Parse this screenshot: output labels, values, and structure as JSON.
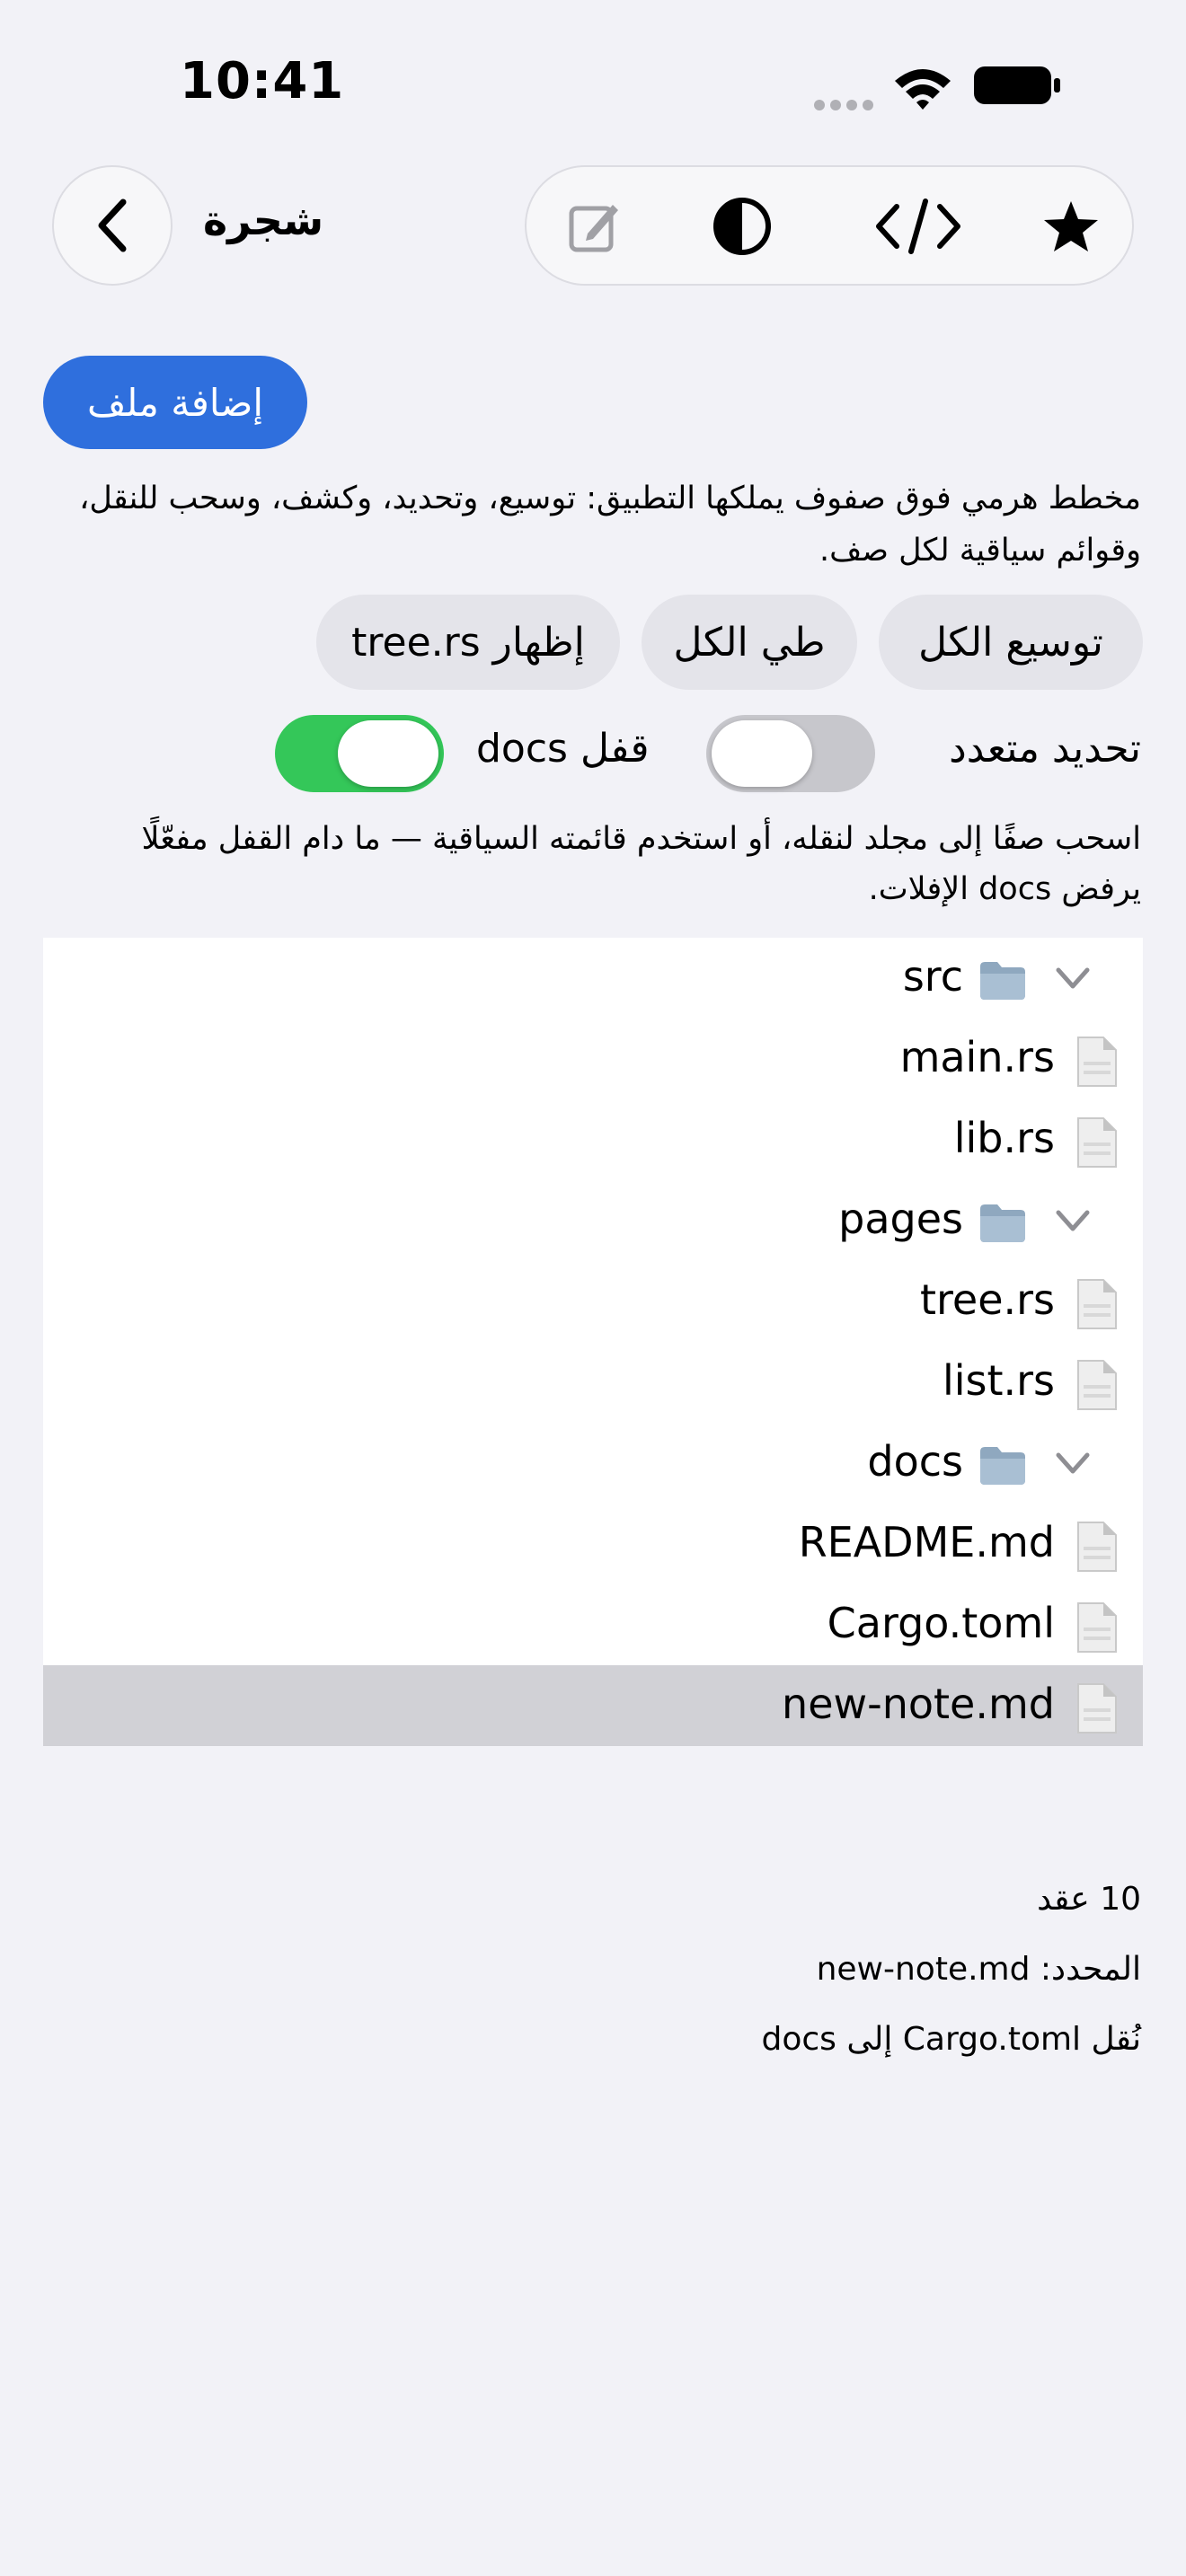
{
  "status_bar": {
    "time": "10:41"
  },
  "nav": {
    "title": "شجرة"
  },
  "actions": {
    "add_file": "إضافة ملف",
    "expand_all": "توسيع الكل",
    "collapse_all": "طي الكل",
    "show_tree": "إظهار tree.rs"
  },
  "description": "مخطط هرمي فوق صفوف يملكها التطبيق: توسيع، وتحديد، وكشف، وسحب للنقل، وقوائم سياقية لكل صف.",
  "toggles": {
    "multi_select": {
      "label": "تحديد متعدد",
      "on": false
    },
    "lock_docs": {
      "label": "قفل docs",
      "on": true
    }
  },
  "hint": "اسحب صفًا إلى مجلد لنقله، أو استخدم قائمته السياقية — ما دام القفل مفعّلًا يرفض docs الإفلات.",
  "tree": {
    "rows": [
      {
        "label": "src",
        "kind": "folder",
        "expanded": true
      },
      {
        "label": "main.rs",
        "kind": "file"
      },
      {
        "label": "lib.rs",
        "kind": "file"
      },
      {
        "label": "pages",
        "kind": "folder",
        "expanded": true
      },
      {
        "label": "tree.rs",
        "kind": "file"
      },
      {
        "label": "list.rs",
        "kind": "file"
      },
      {
        "label": "docs",
        "kind": "folder",
        "expanded": true
      },
      {
        "label": "README.md",
        "kind": "file"
      },
      {
        "label": "Cargo.toml",
        "kind": "file"
      },
      {
        "label": "new-note.md",
        "kind": "file",
        "selected": true
      }
    ]
  },
  "footer": {
    "count": "10 عقد",
    "selected": "المحدد: new-note.md",
    "last_action": "نُقل Cargo.toml إلى docs"
  },
  "colors": {
    "accent": "#2f6fdd",
    "switch_on": "#34c759",
    "switch_off": "#c7c7cc",
    "selection": "#d1d1d6"
  }
}
